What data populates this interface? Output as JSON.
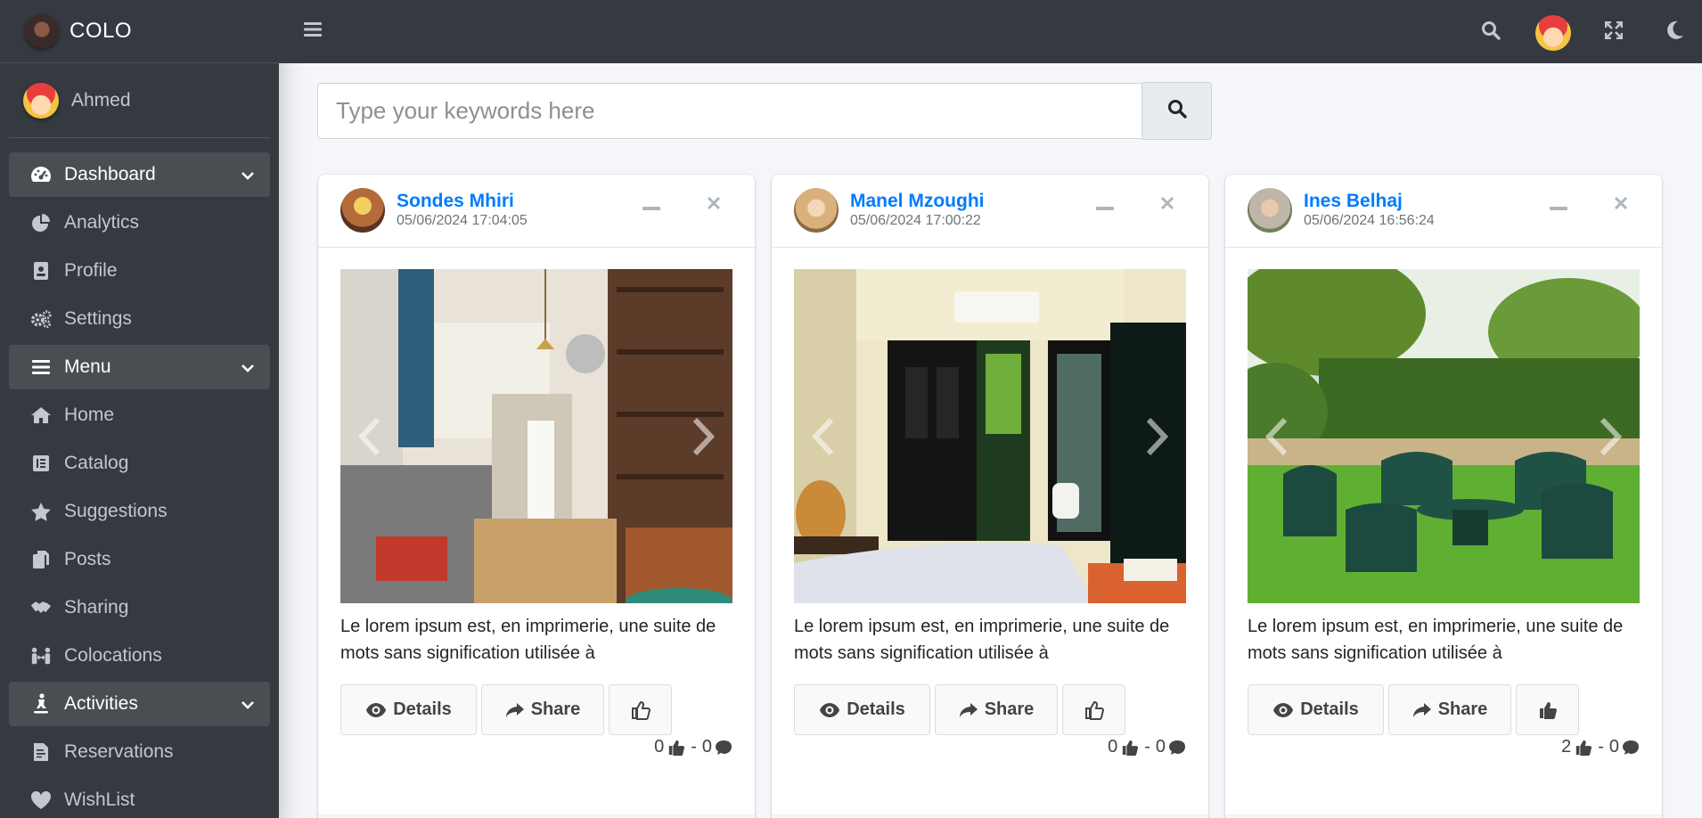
{
  "brand": {
    "name": "COLO"
  },
  "user": {
    "name": "Ahmed"
  },
  "sidebar": {
    "items": [
      {
        "label": "Dashboard",
        "icon": "tachometer-icon",
        "header": true
      },
      {
        "label": "Analytics",
        "icon": "pie-chart-icon"
      },
      {
        "label": "Profile",
        "icon": "id-badge-icon"
      },
      {
        "label": "Settings",
        "icon": "gears-icon"
      },
      {
        "label": "Menu",
        "icon": "bars-icon",
        "header": true
      },
      {
        "label": "Home",
        "icon": "home-icon"
      },
      {
        "label": "Catalog",
        "icon": "catalog-icon"
      },
      {
        "label": "Suggestions",
        "icon": "star-icon"
      },
      {
        "label": "Posts",
        "icon": "copy-icon"
      },
      {
        "label": "Sharing",
        "icon": "handshake-icon"
      },
      {
        "label": "Colocations",
        "icon": "people-arrows-icon"
      },
      {
        "label": "Activities",
        "icon": "person-skating-icon",
        "header": true
      },
      {
        "label": "Reservations",
        "icon": "file-contract-icon"
      },
      {
        "label": "WishList",
        "icon": "heart-icon"
      }
    ]
  },
  "search": {
    "placeholder": "Type your keywords here",
    "value": ""
  },
  "posts": [
    {
      "name": "Sondes Mhiri",
      "date": "05/06/2024 17:04:05",
      "text": "Le lorem ipsum est, en imprimerie, une suite de mots sans signification utilisée à",
      "details": "Details",
      "share": "Share",
      "likes": "0",
      "comments": "0",
      "liked": false,
      "sep": "-",
      "image": "kitchen"
    },
    {
      "name": "Manel Mzoughi",
      "date": "05/06/2024 17:00:22",
      "text": "Le lorem ipsum est, en imprimerie, une suite de mots sans signification utilisée à",
      "details": "Details",
      "share": "Share",
      "likes": "0",
      "comments": "0",
      "liked": false,
      "sep": "-",
      "image": "bedroom"
    },
    {
      "name": "Ines Belhaj",
      "date": "05/06/2024 16:56:24",
      "text": "Le lorem ipsum est, en imprimerie, une suite de mots sans signification utilisée à",
      "details": "Details",
      "share": "Share",
      "likes": "2",
      "comments": "0",
      "liked": true,
      "sep": "-",
      "image": "garden"
    }
  ],
  "colors": {
    "sidebar": "#343a40",
    "accent": "#007bff",
    "header_item": "#494e53"
  }
}
